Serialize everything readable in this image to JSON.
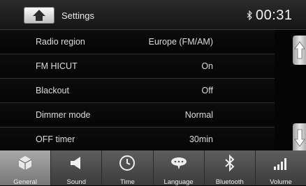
{
  "header": {
    "title": "Settings",
    "time": "00:31"
  },
  "rows": [
    {
      "label": "Radio region",
      "value": "Europe (FM/AM)"
    },
    {
      "label": "FM HICUT",
      "value": "On"
    },
    {
      "label": "Blackout",
      "value": "Off"
    },
    {
      "label": "Dimmer mode",
      "value": "Normal"
    },
    {
      "label": "OFF timer",
      "value": "30min"
    }
  ],
  "tabs": [
    {
      "label": "General",
      "icon": "settings-cube-icon",
      "active": true
    },
    {
      "label": "Sound",
      "icon": "speaker-icon",
      "active": false
    },
    {
      "label": "Time",
      "icon": "clock-icon",
      "active": false
    },
    {
      "label": "Language",
      "icon": "speech-bubble-icon",
      "active": false
    },
    {
      "label": "Bluetooth",
      "icon": "bluetooth-icon",
      "active": false
    },
    {
      "label": "Volume",
      "icon": "volume-bars-icon",
      "active": false
    }
  ]
}
